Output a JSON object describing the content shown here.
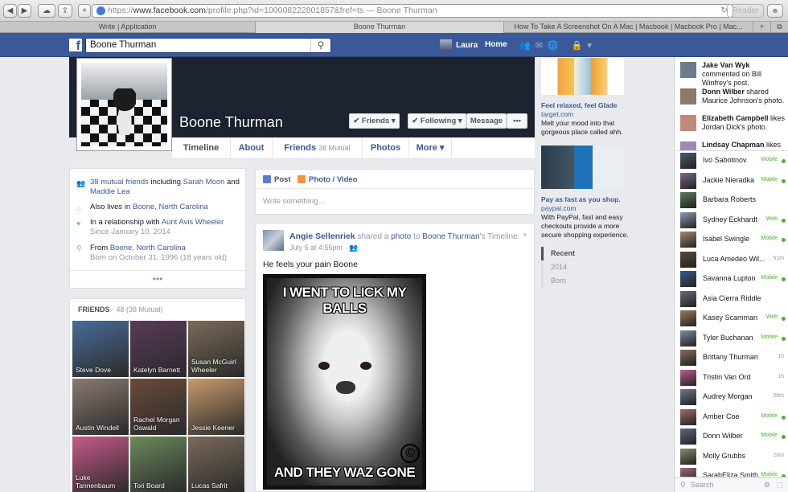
{
  "browser": {
    "url_protocol": "https://",
    "url_host": "www.facebook.com",
    "url_path": "/profile.php?id=100008222801857&fref=ts",
    "url_title": " — Boone Thurman",
    "reader_label": "Reader",
    "tabs": [
      "Write | Application",
      "Boone Thurman",
      "How To Take A Screenshot On A Mac | Macbook | Macbook Pro | Mac..."
    ],
    "new_tab_label": "+"
  },
  "fbbar": {
    "logo": "f",
    "search_value": "Boone Thurman",
    "user_name": "Laura",
    "home_label": "Home"
  },
  "profile": {
    "name": "Boone Thurman",
    "buttons": {
      "friends": "✔ Friends ▾",
      "following": "✔ Following ▾",
      "message": "Message",
      "more": "•••"
    },
    "tabs": {
      "timeline": "Timeline",
      "about": "About",
      "friends": "Friends",
      "friends_count": "38 Mutual",
      "photos": "Photos",
      "more": "More ▾"
    }
  },
  "intro": {
    "mutual_link": "38 mutual friends",
    "mutual_mid": " including ",
    "mutual_f1": "Sarah Moon",
    "mutual_and": " and ",
    "mutual_f2": "Maddie Lea",
    "lives_prefix": "Also lives in ",
    "lives_place": "Boone, North Carolina",
    "rel_prefix": "In a relationship with ",
    "rel_person": "Aunt Avis Wheeler",
    "rel_since": "Since January 10, 2014",
    "from_prefix": "From ",
    "from_place": "Boone, North Carolina",
    "born": "Born on October 31, 1996 (18 years old)",
    "more_dots": "•••"
  },
  "friends_box": {
    "title": "FRIENDS",
    "count": " · 48 (38 Mutual)",
    "tiles": [
      {
        "name": "Steve Dove",
        "color": "#4a6c9a"
      },
      {
        "name": "Katelyn Barnett",
        "color": "#5a3a5a"
      },
      {
        "name": "Susan McGuirl Wheeler",
        "color": "#7a6a58"
      },
      {
        "name": "Austin Windell",
        "color": "#8a7a70"
      },
      {
        "name": "Rachel Morgan Oswald",
        "color": "#6a4a3a"
      },
      {
        "name": "Jessie Keener",
        "color": "#c89a6a"
      },
      {
        "name": "Luke Tannenbaum",
        "color": "#c85a8a"
      },
      {
        "name": "Tori Board",
        "color": "#6a8a5a"
      },
      {
        "name": "Lucas Safrit",
        "color": "#7a6a5a"
      }
    ]
  },
  "composer": {
    "post_tab": "Post",
    "photo_tab": "Photo / Video",
    "placeholder": "Write something..."
  },
  "post": {
    "author": "Angie Sellenriek",
    "shared_a": " shared a ",
    "photo_word": "photo",
    "to": " to ",
    "target": "Boone Thurman",
    "suffix": "'s Timeline.",
    "time": "July 5 at 4:55pm · ",
    "text": "He feels your pain Boone",
    "meme_top": "I WENT TO LICK MY BALLS",
    "meme_bottom": "AND THEY WAZ GONE",
    "meme_copyright": "©"
  },
  "ads": [
    {
      "title": "Feel relaxed, feel Glade",
      "domain": "target.com",
      "desc": "Melt your mood into that gorgeous place called ahh."
    },
    {
      "title": "Pay as fast as you shop.",
      "domain": "paypal.com",
      "desc": "With PayPal, fast and easy checkouts provide a more secure shopping experience."
    }
  ],
  "timeline_nav": [
    "Recent",
    "2014",
    "Born"
  ],
  "ticker": [
    {
      "name": "Jake Van Wyk",
      "action": " commented on Bill Winfrey's post."
    },
    {
      "name": "Donn Wilber",
      "action": " shared Maurice Johnson's photo."
    },
    {
      "name": "Elizabeth Campbell",
      "action": " likes Jordan Dick's photo."
    },
    {
      "name": "Lindsay Chapman",
      "action": " likes"
    }
  ],
  "chat": [
    {
      "name": "Ivo Sabotinov",
      "status": "Mobile",
      "dot": true
    },
    {
      "name": "Jackie Nieradka",
      "status": "Mobile",
      "dot": true
    },
    {
      "name": "Barbara Roberts",
      "status": "",
      "dot": false
    },
    {
      "name": "Sydney Eckhardt",
      "status": "Web",
      "dot": true
    },
    {
      "name": "Isabel Swingle",
      "status": "Mobile",
      "dot": true
    },
    {
      "name": "Luca Amedeo Wil...",
      "status": "51m",
      "dot": false
    },
    {
      "name": "Savanna Lupton",
      "status": "Mobile",
      "dot": true
    },
    {
      "name": "Asia Cierra Riddle",
      "status": "",
      "dot": false
    },
    {
      "name": "Kasey Scamman",
      "status": "Web",
      "dot": true
    },
    {
      "name": "Tyler Buchanan",
      "status": "Mobile",
      "dot": true
    },
    {
      "name": "Brittany Thurman",
      "status": "1h",
      "dot": false
    },
    {
      "name": "Tristin Van Ord",
      "status": "1h",
      "dot": false
    },
    {
      "name": "Audrey Morgan",
      "status": "28m",
      "dot": false
    },
    {
      "name": "Amber Coe",
      "status": "Mobile",
      "dot": true
    },
    {
      "name": "Donn Wilber",
      "status": "Mobile",
      "dot": true
    },
    {
      "name": "Molly Grubbs",
      "status": "20m",
      "dot": false
    },
    {
      "name": "SarahEliza Smith",
      "status": "Mobile",
      "dot": true
    }
  ],
  "chat_search": "Search",
  "colors": {
    "fb_blue": "#3b5998",
    "online_green": "#42b72a"
  }
}
